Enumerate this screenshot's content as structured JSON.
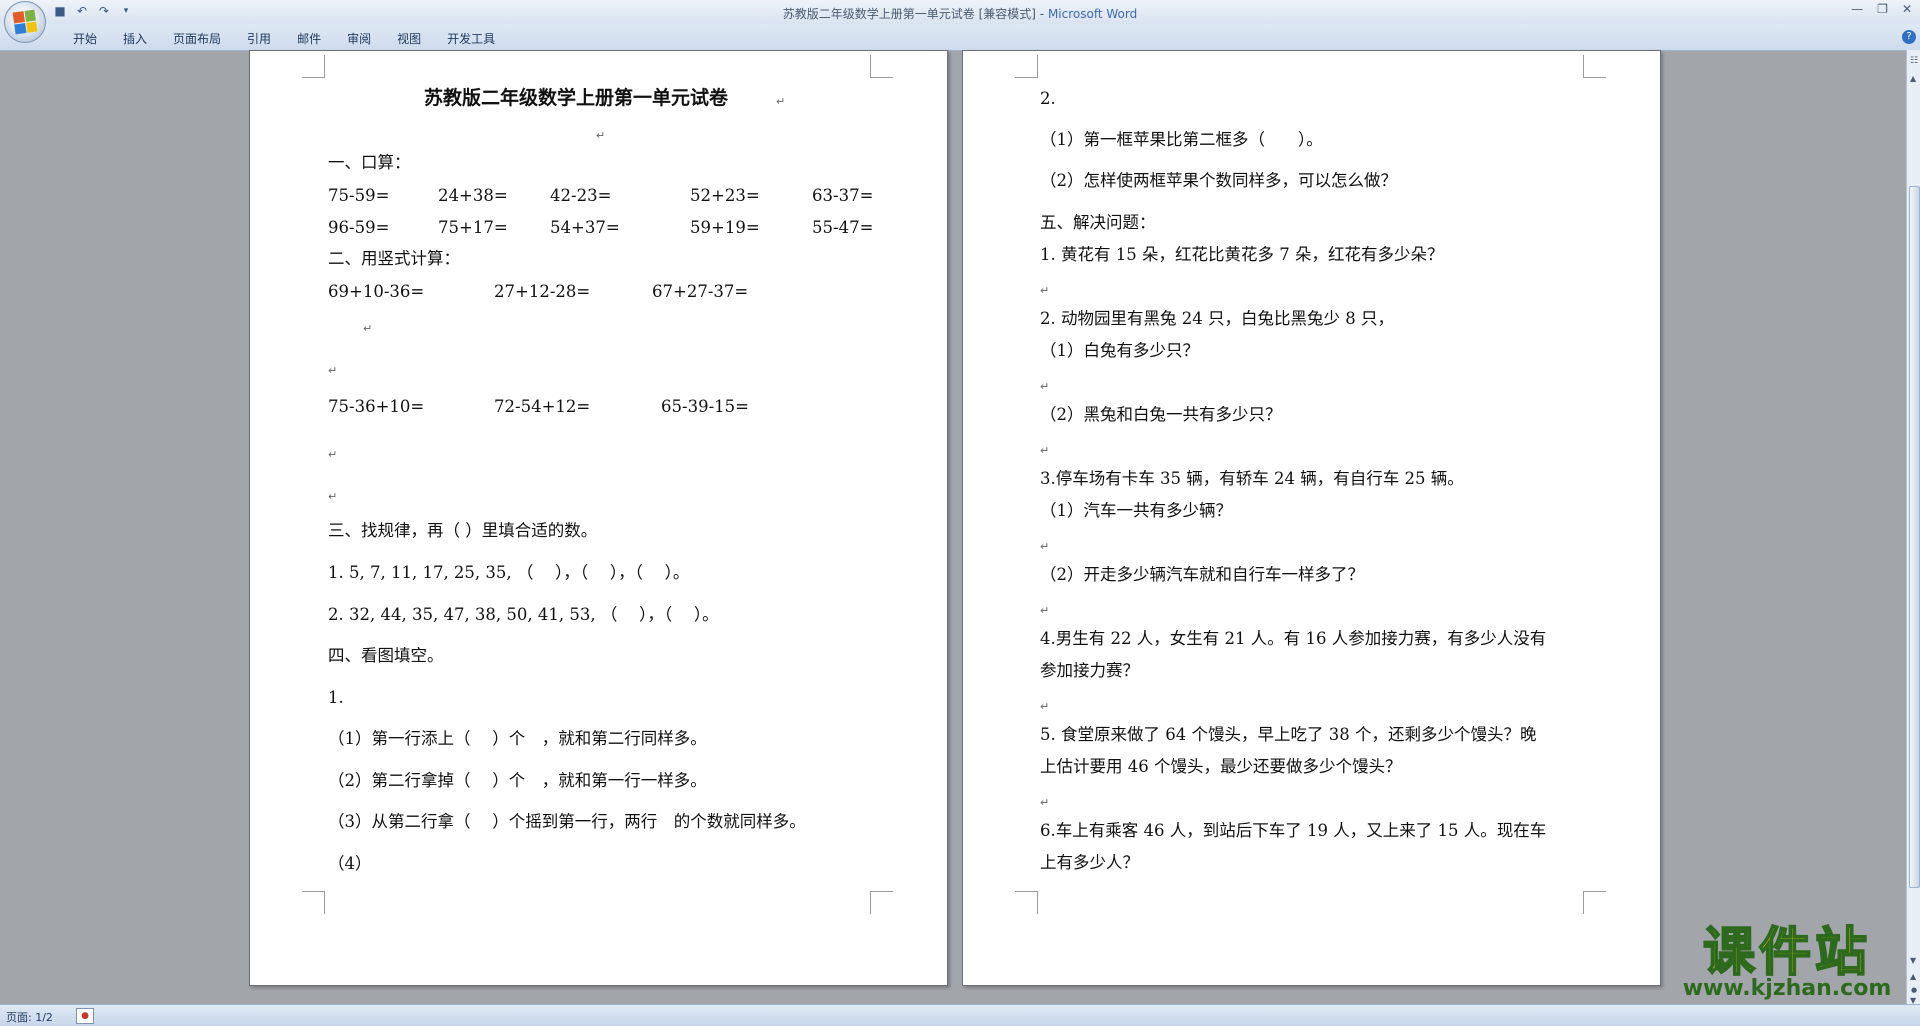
{
  "window": {
    "title": "苏教版二年级数学上册第一单元试卷 [兼容模式]",
    "app_name": "Microsoft Word",
    "title_separator": " - ",
    "controls": [
      "minimize",
      "restore",
      "close"
    ]
  },
  "ribbon": {
    "tabs": [
      "开始",
      "插入",
      "页面布局",
      "引用",
      "邮件",
      "审阅",
      "视图",
      "开发工具"
    ]
  },
  "quick_access": [
    "save-icon",
    "undo-icon",
    "redo-icon",
    "customize-icon"
  ],
  "page1": {
    "title": "苏教版二年级数学上册第一单元试卷",
    "s1": "一、口算：",
    "r1": [
      "75-59=",
      "24+38=",
      "42-23=",
      "52+23=",
      "63-37="
    ],
    "r2": [
      "96-59=",
      "75+17=",
      "54+37=",
      "59+19=",
      "55-47="
    ],
    "s2": "二、用竖式计算：",
    "v1": [
      "69+10-36=",
      "27+12-28=",
      "67+27-37="
    ],
    "v2": [
      "75-36+10=",
      "72-54+12=",
      "65-39-15="
    ],
    "s3": "三、找规律，再（ ）里填合适的数。",
    "p1": "1. 5, 7, 11, 17, 25, 35, （　 ），（　 ），（　 ）。",
    "p2": "2. 32, 44, 35, 47, 38, 50, 41, 53, （　 ），（　 ）。",
    "s4": "四、看图填空。",
    "i1": "1.",
    "q1": "（1）第一行添上（　 ）个　，就和第二行同样多。",
    "q2": "（2）第二行拿掉（　 ）个　，就和第一行一样多。",
    "q3": "（3）从第二行拿（　 ）个摇到第一行，两行　的个数就同样多。",
    "q4": "（4）"
  },
  "page2": {
    "i2": "2.",
    "a1": "（1）第一框苹果比第二框多（　　）。",
    "a2": "（2）怎样使两框苹果个数同样多，可以怎么做？",
    "s5": "五、解决问题：",
    "w1": "1. 黄花有 15 朵，红花比黄花多 7 朵，红花有多少朵？",
    "w2": "2. 动物园里有黑兔 24 只，白兔比黑兔少 8 只，",
    "w2a": "（1）白兔有多少只？",
    "w2b": "（2）黑兔和白兔一共有多少只？",
    "w3": "3.停车场有卡车 35 辆，有轿车 24 辆，有自行车 25 辆。",
    "w3a": "（1）汽车一共有多少辆？",
    "w3b": "（2）开走多少辆汽车就和自行车一样多了？",
    "w4": "4.男生有 22 人，女生有 21 人。有 16 人参加接力赛，有多少人没有",
    "w4c": "参加接力赛？",
    "w5": "5. 食堂原来做了 64 个馒头，早上吃了 38 个，还剩多少个馒头？晚",
    "w5c": "上估计要用 46 个馒头，最少还要做多少个馒头？",
    "w6": "6.车上有乘客 46 人，到站后下车了 19 人，又上来了 15 人。现在车",
    "w6c": "上有多少人？"
  },
  "status": {
    "page": "页面: 1/2"
  },
  "watermark": {
    "text": "课件站",
    "url": "www.kjzhan.com"
  },
  "paragraph_mark": "↵"
}
